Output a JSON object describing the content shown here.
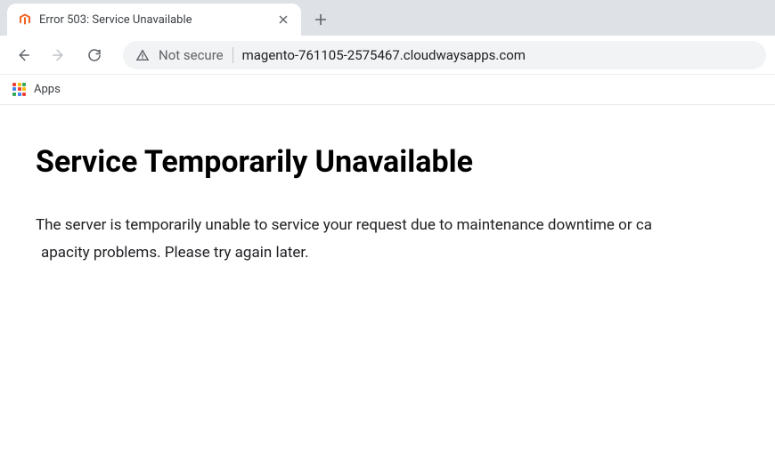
{
  "tab": {
    "title": "Error 503: Service Unavailable"
  },
  "omnibox": {
    "security_label": "Not secure",
    "url": "magento-761105-2575467.cloudwaysapps.com"
  },
  "bookmarks": {
    "apps_label": "Apps"
  },
  "page": {
    "heading": "Service Temporarily Unavailable",
    "body_line1": "The server is temporarily unable to service your request due to maintenance downtime or ca",
    "body_line2": "apacity problems. Please try again later."
  }
}
